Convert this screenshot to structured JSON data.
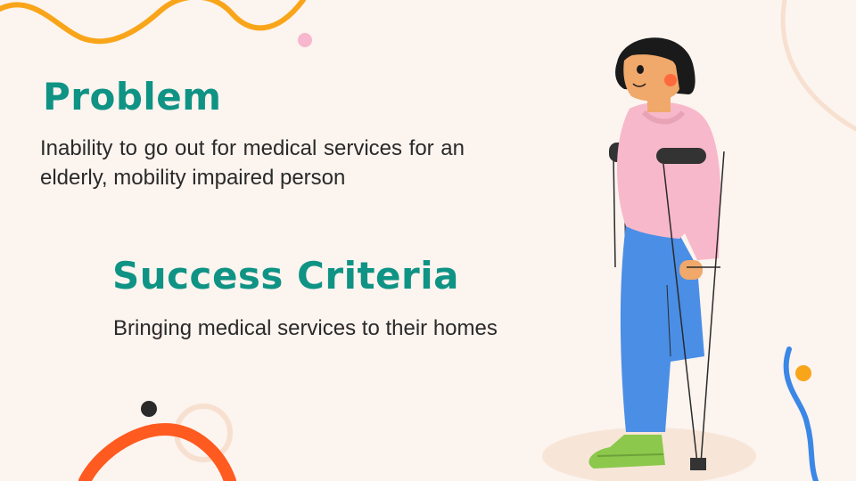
{
  "slide": {
    "problem": {
      "title": "Problem",
      "text": "Inability to go out for medical services for an elderly, mobility impaired person"
    },
    "success_criteria": {
      "title": "Success Criteria",
      "text": "Bringing medical services to their homes"
    }
  },
  "colors": {
    "background": "#fcf4ef",
    "heading": "#0f9384",
    "body_text": "#2a2a2a",
    "accent_orange": "#f9a51a",
    "accent_red": "#ff5a1f",
    "accent_pink": "#f7b7cc",
    "accent_blue": "#3b87e6",
    "sweater": "#f8b8cb",
    "pants": "#4a8ee6",
    "shoes": "#8cc84b"
  },
  "illustration": {
    "subject": "person-on-crutches-illustration"
  }
}
